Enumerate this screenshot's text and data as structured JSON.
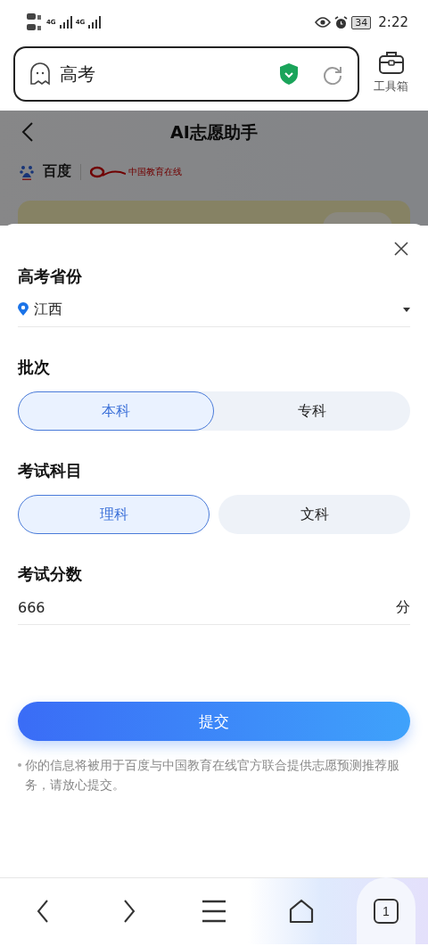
{
  "status_bar": {
    "network_1": "4G",
    "network_2": "4G",
    "battery": "34",
    "time": "2:22"
  },
  "address_bar": {
    "query": "高考",
    "toolbox_label": "工具箱"
  },
  "background_page": {
    "title": "AI志愿助手",
    "logos": [
      "百度",
      "中国教育在线"
    ]
  },
  "form": {
    "fields": [
      {
        "kind": "select",
        "label": "高考省份",
        "value": "江西"
      },
      {
        "kind": "segments",
        "label": "批次",
        "joined": true,
        "options": [
          {
            "label": "本科",
            "selected": true
          },
          {
            "label": "专科",
            "selected": false
          }
        ]
      },
      {
        "kind": "segments",
        "label": "考试科目",
        "joined": false,
        "options": [
          {
            "label": "理科",
            "selected": true
          },
          {
            "label": "文科",
            "selected": false
          }
        ]
      },
      {
        "kind": "number",
        "label": "考试分数",
        "value": "666",
        "unit": "分"
      }
    ],
    "submit": "提交",
    "notice": "你的信息将被用于百度与中国教育在线官方联合提供志愿预测推荐服务，请放心提交。"
  },
  "bottom_nav": {
    "tab_count": "1"
  }
}
